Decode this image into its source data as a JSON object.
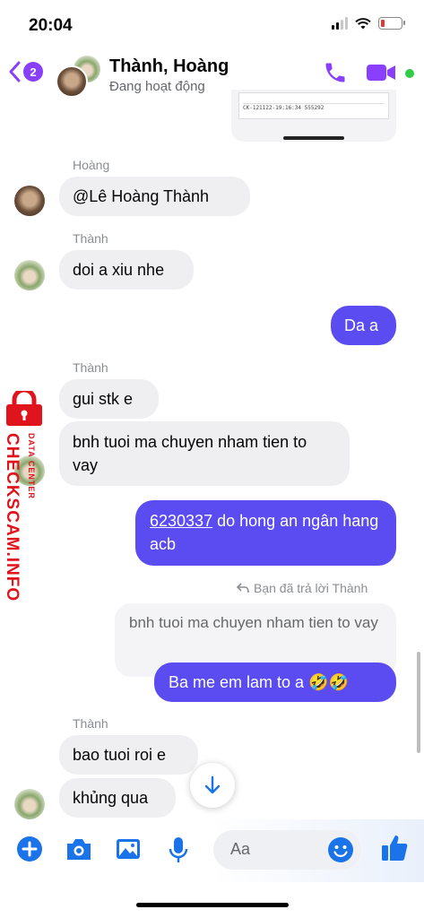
{
  "status": {
    "time": "20:04"
  },
  "header": {
    "back_badge": "2",
    "title": "Thành, Hoàng",
    "subtitle": "Đang hoạt động"
  },
  "image_preview_lines": [
    "CK-121122-19:16:34 555292"
  ],
  "messages": [
    {
      "sender": "Hoàng",
      "text": "@Lê Hoàng Thành"
    },
    {
      "sender": "Thành",
      "text": "doi a xiu nhe"
    },
    {
      "outgoing": true,
      "text": "Da a"
    },
    {
      "sender": "Thành",
      "text": "gui stk e"
    },
    {
      "text": "bnh tuoi ma chuyen nham tien to vay"
    },
    {
      "outgoing": true,
      "link_text": "6230337",
      "text": " do hong an ngân hang acb"
    },
    {
      "reply_note": "Bạn đã trả lời Thành"
    },
    {
      "quoted": "bnh tuoi ma chuyen nham tien to vay"
    },
    {
      "outgoing": true,
      "text": "Ba me em lam to a 🤣🤣"
    },
    {
      "sender": "Thành",
      "text": "bao tuoi roi e"
    },
    {
      "text": "khủng qua"
    }
  ],
  "composer": {
    "placeholder": "Aa"
  },
  "watermark": {
    "main": "CHECKSCAM.INFO",
    "small": "DATA CENTER"
  },
  "colors": {
    "accent": "#8a3ffc",
    "outgoing_bubble": "#5a4cf0",
    "incoming_bubble": "#efeff1",
    "online": "#31cc46"
  },
  "icons": [
    "back-chevron-icon",
    "phone-icon",
    "video-camera-icon",
    "plus-circle-icon",
    "camera-icon",
    "image-icon",
    "microphone-icon",
    "emoji-icon",
    "thumbs-up-icon",
    "arrow-down-icon",
    "reply-arrow-icon"
  ]
}
